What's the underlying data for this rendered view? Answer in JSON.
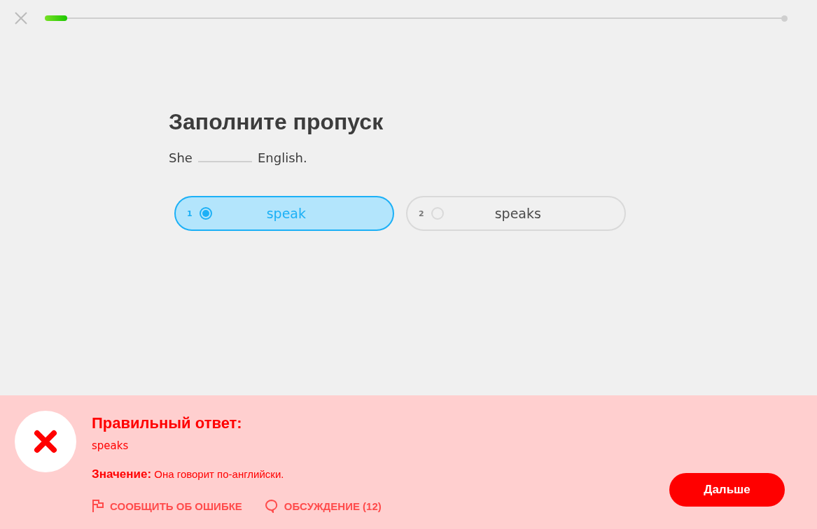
{
  "progress": {
    "level": 0.03
  },
  "prompt": {
    "title": "Заполните пропуск",
    "before": "She",
    "after": "English."
  },
  "choices": [
    {
      "key": "1",
      "label": "speak",
      "selected": true
    },
    {
      "key": "2",
      "label": "speaks",
      "selected": false
    }
  ],
  "feedback": {
    "correct": false,
    "heading": "Правильный ответ:",
    "answer": "speaks",
    "meaning": "**Значение:** Она говорит по-английски.",
    "report": "СООБЩИТЬ ОБ ОШИБКЕ",
    "discussion": "ОБСУЖДЕНИЕ (12)",
    "next": "Дальше"
  }
}
